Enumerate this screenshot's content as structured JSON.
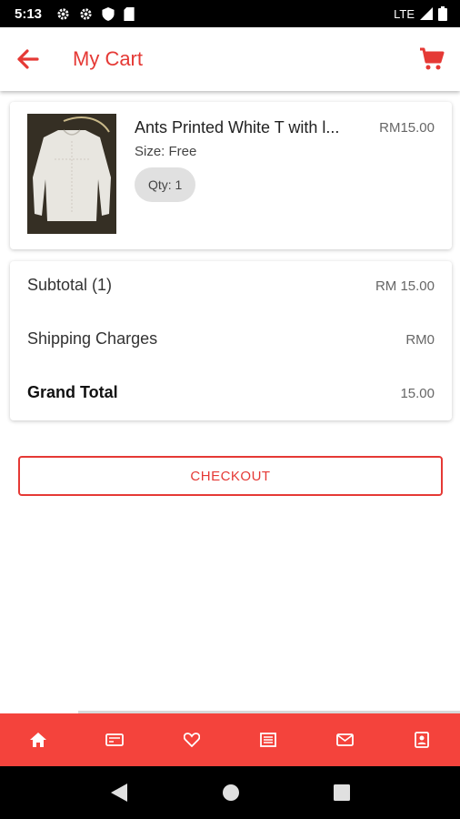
{
  "status_bar": {
    "time": "5:13",
    "network": "LTE"
  },
  "header": {
    "title": "My Cart"
  },
  "cart_items": [
    {
      "name": "Ants Printed White T with l...",
      "price": "RM15.00",
      "size": "Size: Free",
      "qty": "Qty: 1"
    }
  ],
  "summary": {
    "subtotal_label": "Subtotal (1)",
    "subtotal_value": "RM 15.00",
    "shipping_label": "Shipping Charges",
    "shipping_value": "RM0",
    "grand_total_label": "Grand Total",
    "grand_total_value": "15.00"
  },
  "checkout": {
    "label": "CHECKOUT"
  },
  "bottom_nav": {
    "items": [
      "home-icon",
      "wallet-icon",
      "heart-icon",
      "list-icon",
      "mail-icon",
      "contact-icon"
    ],
    "active_index": 0
  },
  "colors": {
    "accent": "#e53935",
    "nav_bg": "#f4433c"
  }
}
